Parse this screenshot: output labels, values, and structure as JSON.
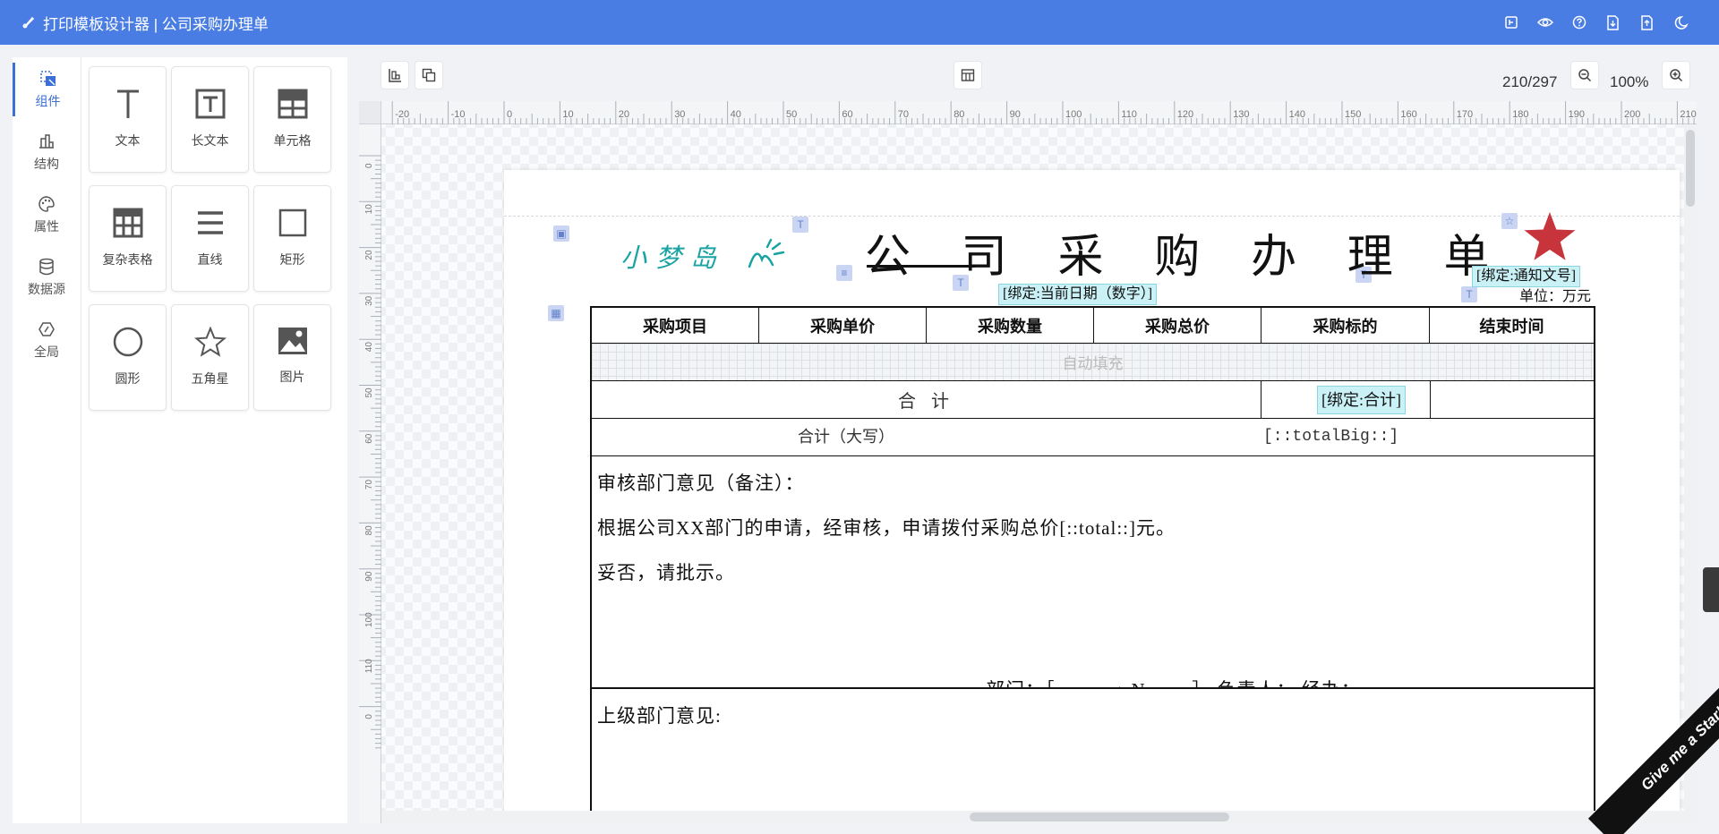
{
  "header": {
    "title": "打印模板设计器 | 公司采购办理单",
    "actions": [
      "bind-template-icon",
      "preview-eye-icon",
      "help-icon",
      "import-file-icon",
      "export-file-icon",
      "theme-toggle-icon"
    ]
  },
  "nav": {
    "items": [
      {
        "label": "组件",
        "icon": "components-icon"
      },
      {
        "label": "结构",
        "icon": "structure-icon"
      },
      {
        "label": "属性",
        "icon": "palette-icon"
      },
      {
        "label": "数据源",
        "icon": "database-icon"
      },
      {
        "label": "全局",
        "icon": "global-icon"
      }
    ],
    "active": "组件"
  },
  "palette": {
    "tools": [
      {
        "label": "文本",
        "icon": "text-icon"
      },
      {
        "label": "长文本",
        "icon": "long-text-icon"
      },
      {
        "label": "单元格",
        "icon": "cell-icon"
      },
      {
        "label": "复杂表格",
        "icon": "complex-table-icon"
      },
      {
        "label": "直线",
        "icon": "line-icon"
      },
      {
        "label": "矩形",
        "icon": "rectangle-icon"
      },
      {
        "label": "圆形",
        "icon": "circle-icon"
      },
      {
        "label": "五角星",
        "icon": "star-icon"
      },
      {
        "label": "图片",
        "icon": "image-icon"
      }
    ]
  },
  "toolbar": {
    "page_size": "210/297",
    "zoom": "100%"
  },
  "ruler": {
    "h_labels": [
      "-20",
      "-10",
      "0",
      "10",
      "20",
      "30",
      "40",
      "50",
      "60",
      "70",
      "80",
      "90",
      "100",
      "110",
      "120",
      "130",
      "140",
      "150",
      "160",
      "170",
      "180",
      "190",
      "200",
      "210"
    ],
    "v_labels": [
      "0",
      "10",
      "20",
      "30",
      "40",
      "50",
      "60",
      "70",
      "80",
      "90",
      "100",
      "110",
      "0"
    ]
  },
  "document": {
    "title": "公 司 采 购 办 理 单",
    "logo_text": "小梦岛",
    "bind_notice": "[绑定:通知文号]",
    "bind_date": "[绑定:当前日期（数字）]",
    "unit": "单位：万元",
    "headers": [
      "采购项目",
      "采购单价",
      "采购数量",
      "采购总价",
      "采购标的",
      "结束时间"
    ],
    "autofill": "自动填充",
    "total_label": "合 计",
    "bind_total": "[绑定:合计]",
    "total_big_label": "合计（大写）",
    "total_big_value": "[::totalBig::]",
    "review_title": "审核部门意见（备注）：",
    "review_line1": "根据公司XX部门的申请，经审核，申请拨付采购总价[::total::]元。",
    "review_line2": "妥否，请批示。",
    "review_footer": "部门：［::manageName::］ 负责人：        经办：",
    "upper_title": "上级部门意见:"
  },
  "ribbon": "Give me a Star!",
  "colors": {
    "header": "#4a7de3",
    "accent": "#3b6fd8",
    "star": "#c8343c",
    "bind_bg": "#c9f1f6",
    "logo": "#1aa3a3"
  }
}
